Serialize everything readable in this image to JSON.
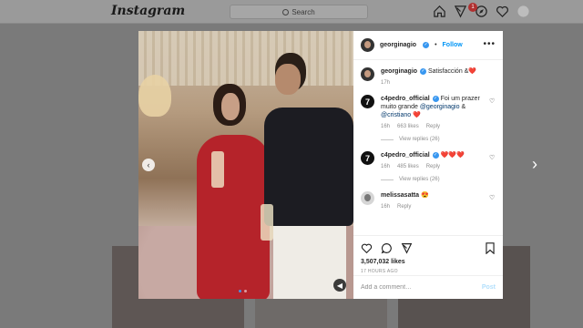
{
  "topbar": {
    "logo": "Instagram",
    "search_placeholder": "Search",
    "notification_count": "1"
  },
  "post": {
    "author": "georginagio",
    "follow_label": "Follow",
    "separator": "•",
    "likes": "3,507,032 likes",
    "time_ago": "17 HOURS AGO"
  },
  "comments": [
    {
      "user": "georginagio",
      "text": "Satisfacción &",
      "heart": "❤️",
      "meta_time": "17h"
    },
    {
      "user": "c4pedro_official",
      "text_pre": "Foi um prazer muito grande",
      "mention1": "@georginagio",
      "amp": "&",
      "mention2": "@cristiano",
      "heart": "❤️",
      "meta_time": "16h",
      "meta_likes": "663 likes",
      "meta_reply": "Reply",
      "replies": "View replies (26)"
    },
    {
      "user": "c4pedro_official",
      "text": "❤️❤️❤️",
      "meta_time": "16h",
      "meta_likes": "485 likes",
      "meta_reply": "Reply",
      "replies": "View replies (26)"
    },
    {
      "user": "melissasatta",
      "text": "😍",
      "meta_time": "16h",
      "meta_likes": "",
      "meta_reply": "Reply"
    }
  ],
  "add_comment": {
    "placeholder": "Add a comment…",
    "post_label": "Post"
  },
  "icons": [
    "home-icon",
    "direct-icon",
    "explore-icon",
    "heart-icon",
    "profile-icon",
    "more-icon",
    "like-icon",
    "comment-icon",
    "share-icon",
    "save-icon",
    "mute-icon",
    "chevron-left-icon",
    "chevron-right-icon"
  ],
  "colors": {
    "accent": "#0095f6",
    "badge": "#ed4956",
    "dress": "#b5232a"
  }
}
